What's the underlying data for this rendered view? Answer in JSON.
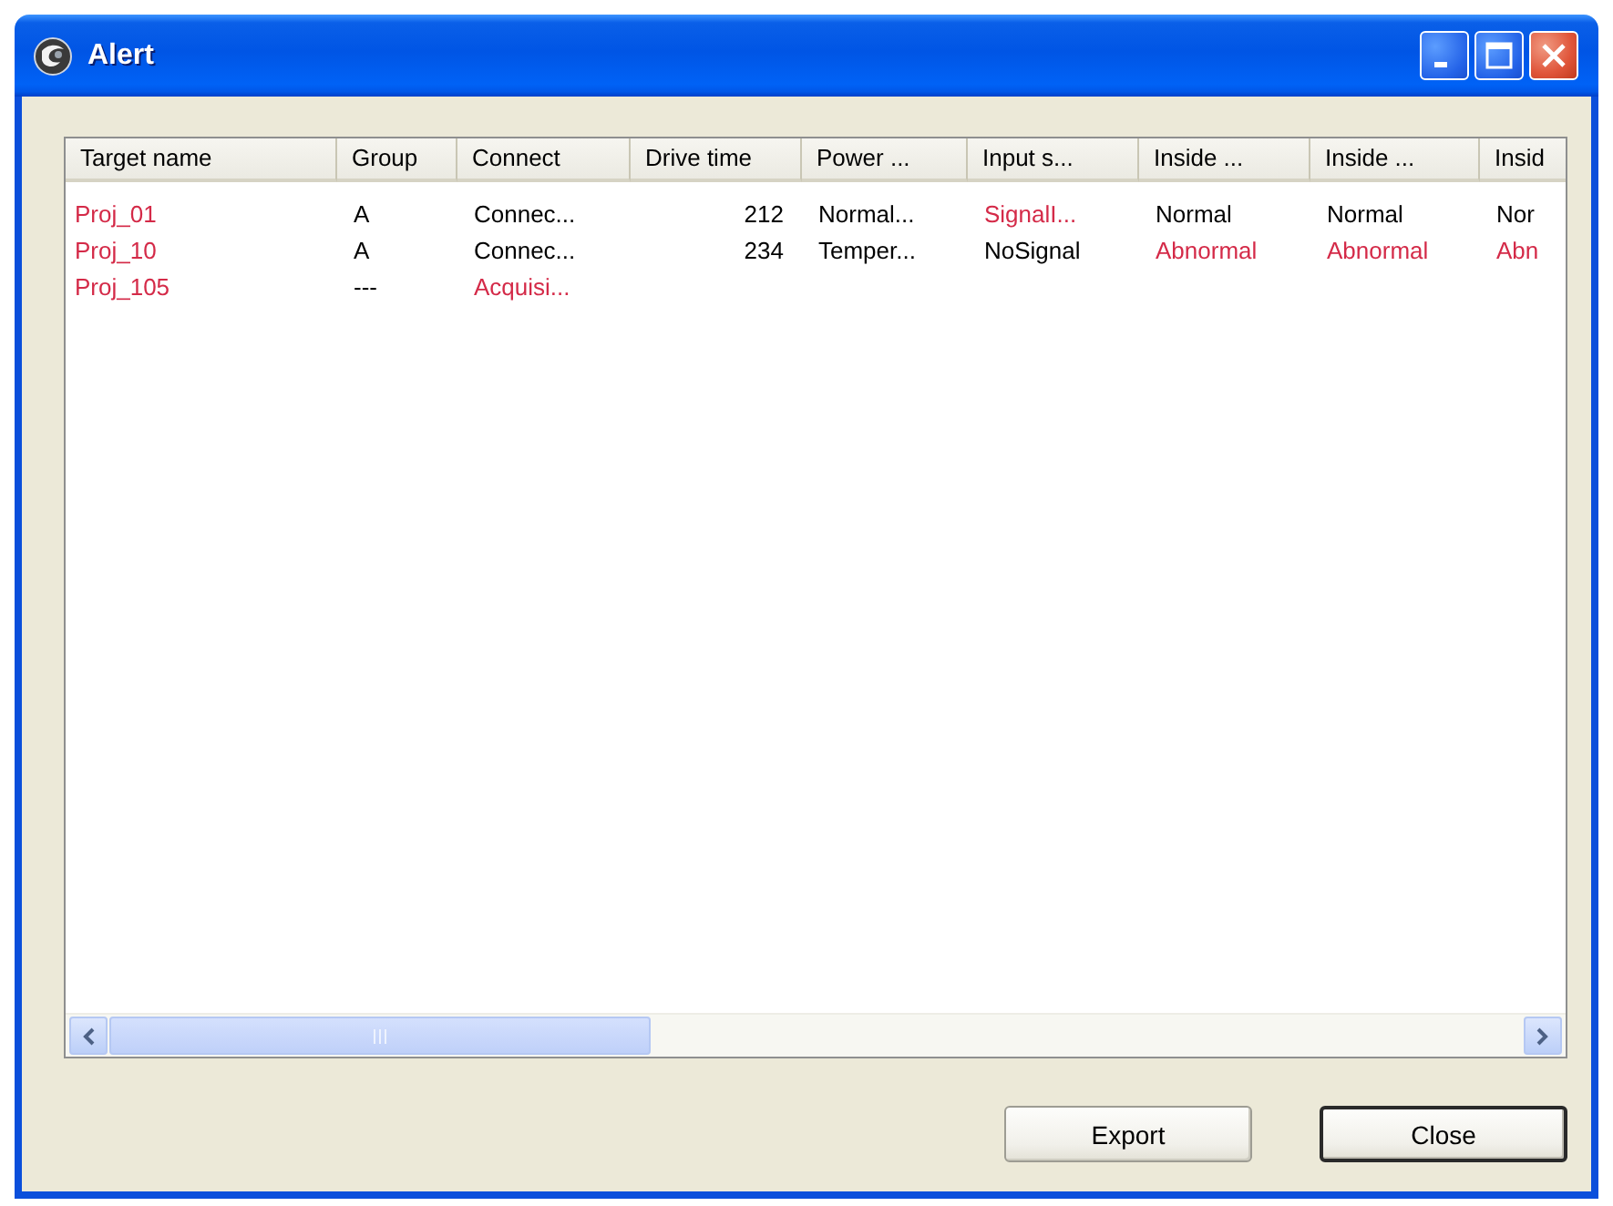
{
  "window": {
    "title": "Alert"
  },
  "table": {
    "columns": [
      {
        "label": "Target name",
        "kind": "text"
      },
      {
        "label": "Group",
        "kind": "text"
      },
      {
        "label": "Connect",
        "kind": "text"
      },
      {
        "label": "Drive time",
        "kind": "number"
      },
      {
        "label": "Power ...",
        "kind": "text"
      },
      {
        "label": "Input s...",
        "kind": "text"
      },
      {
        "label": "Inside ...",
        "kind": "text"
      },
      {
        "label": "Inside ...",
        "kind": "text"
      },
      {
        "label": "Insid",
        "kind": "text"
      }
    ],
    "rows": [
      {
        "cells": [
          {
            "text": "Proj_01",
            "alert": true
          },
          {
            "text": "A",
            "alert": false
          },
          {
            "text": "Connec...",
            "alert": false
          },
          {
            "text": "212",
            "alert": false
          },
          {
            "text": "Normal...",
            "alert": false
          },
          {
            "text": "SignalI...",
            "alert": true
          },
          {
            "text": "Normal",
            "alert": false
          },
          {
            "text": "Normal",
            "alert": false
          },
          {
            "text": "Nor",
            "alert": false
          }
        ]
      },
      {
        "cells": [
          {
            "text": "Proj_10",
            "alert": true
          },
          {
            "text": "A",
            "alert": false
          },
          {
            "text": "Connec...",
            "alert": false
          },
          {
            "text": "234",
            "alert": false
          },
          {
            "text": "Temper...",
            "alert": false
          },
          {
            "text": "NoSignal",
            "alert": false
          },
          {
            "text": "Abnormal",
            "alert": true
          },
          {
            "text": "Abnormal",
            "alert": true
          },
          {
            "text": "Abn",
            "alert": true
          }
        ]
      },
      {
        "cells": [
          {
            "text": "Proj_105",
            "alert": true
          },
          {
            "text": "---",
            "alert": false
          },
          {
            "text": "Acquisi...",
            "alert": true
          }
        ]
      }
    ]
  },
  "buttons": [
    {
      "label": "Export",
      "default": false
    },
    {
      "label": "Close",
      "default": true
    }
  ]
}
